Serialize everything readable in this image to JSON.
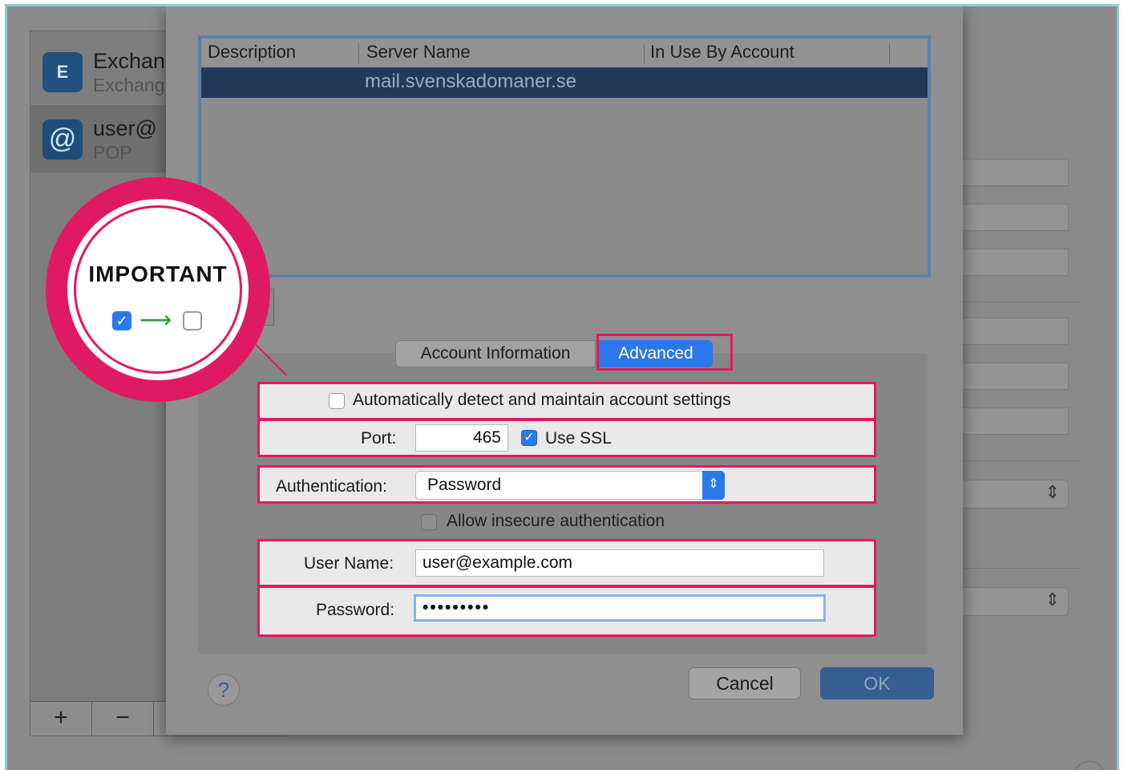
{
  "sidebar": {
    "accounts": [
      {
        "title": "Exchan",
        "subtitle": "Exchang",
        "icon": "exchange-icon",
        "icon_text": "E"
      },
      {
        "title": "user@",
        "subtitle": "POP",
        "icon": "at-icon",
        "icon_text": "@"
      }
    ],
    "add_label": "+",
    "remove_label": "−"
  },
  "table": {
    "headers": [
      "Description",
      "Server Name",
      "In Use By Account"
    ],
    "rows": [
      {
        "description": "",
        "server_name": "mail.svenskadomaner.se",
        "in_use": ""
      }
    ]
  },
  "tabs": {
    "account_information": "Account Information",
    "advanced": "Advanced",
    "active": "Advanced"
  },
  "advanced": {
    "auto_detect_label": "Automatically detect and maintain account settings",
    "auto_detect_checked": false,
    "port_label": "Port:",
    "port_value": "465",
    "use_ssl_label": "Use SSL",
    "use_ssl_checked": true,
    "authentication_label": "Authentication:",
    "authentication_value": "Password",
    "allow_insecure_label": "Allow insecure authentication",
    "allow_insecure_checked": false,
    "user_name_label": "User Name:",
    "user_name_value": "user@example.com",
    "password_label": "Password:",
    "password_value": "•••••••••"
  },
  "buttons": {
    "help": "?",
    "cancel": "Cancel",
    "ok": "OK"
  },
  "callout": {
    "title": "IMPORTANT",
    "arrow": "⟶"
  },
  "colors": {
    "highlight": "#e01a62",
    "accent": "#2a78ea",
    "selection": "#23395a"
  }
}
